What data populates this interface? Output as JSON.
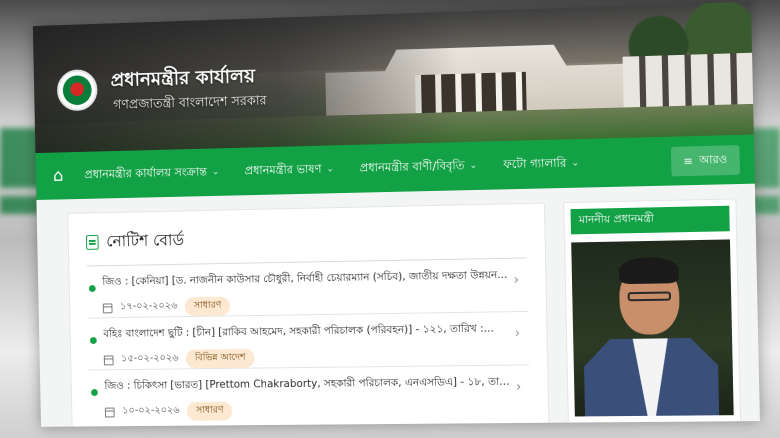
{
  "header": {
    "title": "প্রধানমন্ত্রীর কার্যালয়",
    "subtitle": "গণপ্রজাতন্ত্রী বাংলাদেশ সরকার"
  },
  "nav": {
    "items": [
      {
        "label": "প্রধানমন্ত্রীর কার্যালয় সংক্রান্ত"
      },
      {
        "label": "প্রধানমন্ত্রীর ভাষণ"
      },
      {
        "label": "প্রধানমন্ত্রীর বাণী/বিবৃতি"
      },
      {
        "label": "ফটো গ্যালারি"
      }
    ],
    "more_label": "আরও"
  },
  "notice_board": {
    "title": "নোটিশ বোর্ড",
    "items": [
      {
        "title": "জিও : [কেনিয়া] [ড. নাজনীন কাউসার চৌধুরী, নির্বাহী চেয়ারম্যান (সচিব), জাতীয় দক্ষতা উন্নয়ন...",
        "date": "১৭-০২-২০২৬",
        "tag": "সাধারণ"
      },
      {
        "title": "বহিঃ বাংলাদেশ ছুটি : [চীন] [রাকিব আহমেদ, সহকারী পরিচালক (পরিবহন)] - ১২১, তারিখ :...",
        "date": "১৫-০২-২০২৬",
        "tag": "বিভিন্ন আদেশ"
      },
      {
        "title": "জিও : চিকিৎসা [ভারত] [Prettom Chakraborty, সহকারী পরিচালক, এনএসডিএ] - ১৮, তারিখ :...",
        "date": "১০-০২-২০২৬",
        "tag": "সাধারণ"
      }
    ]
  },
  "sidebar": {
    "pm_heading": "মাননীয় প্রধানমন্ত্রী"
  },
  "colors": {
    "brand_green": "#13a146",
    "tag_bg": "#fde9d2"
  }
}
